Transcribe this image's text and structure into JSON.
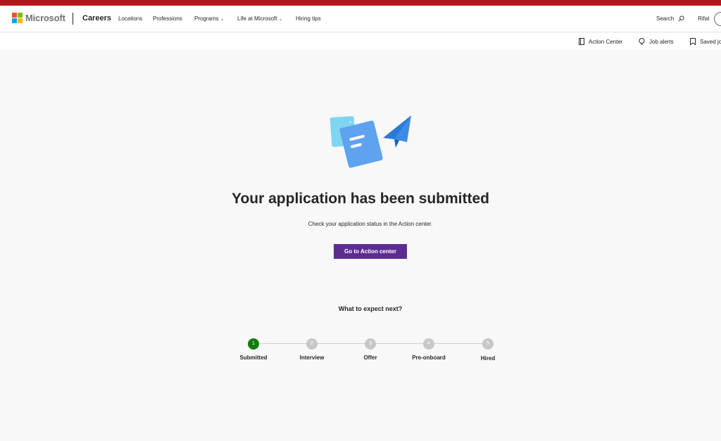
{
  "header": {
    "brand": "Microsoft",
    "site": "Careers",
    "nav": [
      {
        "label": "Locations",
        "has_menu": false
      },
      {
        "label": "Professions",
        "has_menu": false
      },
      {
        "label": "Programs",
        "has_menu": true
      },
      {
        "label": "Life at Microsoft",
        "has_menu": true
      },
      {
        "label": "Hiring tips",
        "has_menu": false
      }
    ],
    "search_label": "Search",
    "user_name": "Rifat"
  },
  "subbar": {
    "action_center": "Action Center",
    "job_alerts": "Job alerts",
    "saved_jobs": "Saved jo"
  },
  "main": {
    "headline": "Your application has been submitted",
    "subtext": "Check your application status in the Action center.",
    "cta_label": "Go to Action center",
    "expect_title": "What to expect next?"
  },
  "steps": [
    {
      "number": "1",
      "label": "Submitted",
      "active": true
    },
    {
      "number": "2",
      "label": "Interview",
      "active": false
    },
    {
      "number": "3",
      "label": "Offer",
      "active": false
    },
    {
      "number": "4",
      "label": "Pre-onboard",
      "active": false
    },
    {
      "number": "5",
      "label": "Hired",
      "active": false
    }
  ],
  "colors": {
    "accent_purple": "#5c2d91",
    "step_active": "#107c10",
    "step_inactive": "#c8c8c8",
    "ms_red": "#f25022",
    "ms_green": "#7fba00",
    "ms_blue": "#00a4ef",
    "ms_yellow": "#ffb900"
  },
  "icons": {
    "search": "search-icon",
    "action_center": "document-icon",
    "job_alerts": "lightbulb-icon",
    "saved_jobs": "bookmark-icon",
    "illustration": "paper-plane-document-illustration"
  }
}
